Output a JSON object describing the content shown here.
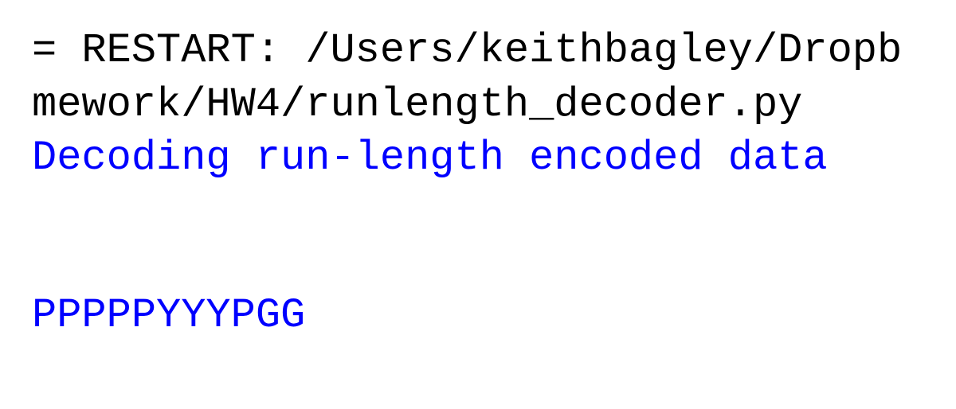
{
  "console": {
    "restart_prefix": "= RESTART: ",
    "restart_path_line1": "/Users/keithbagley/Dropb",
    "restart_path_line2": "mework/HW4/runlength_decoder.py",
    "output_message": "Decoding run-length encoded data",
    "output_result": "PPPPPYYYPGG"
  }
}
